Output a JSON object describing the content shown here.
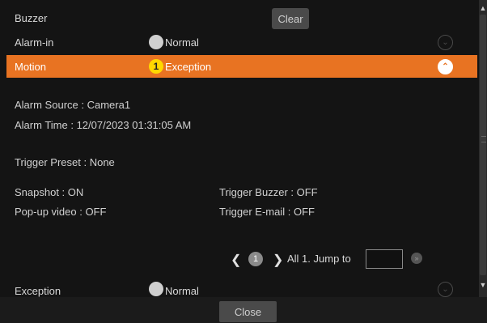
{
  "header": {
    "title": "Buzzer",
    "clear_label": "Clear"
  },
  "rows": [
    {
      "name": "Alarm-in",
      "status": "Normal"
    },
    {
      "name": "Motion",
      "status": "Exception",
      "badge": "1"
    },
    {
      "name": "Exception",
      "status": "Normal"
    }
  ],
  "details": {
    "alarm_source": "Alarm Source   : Camera1",
    "alarm_time": "Alarm Time    : 12/07/2023 01:31:05 AM",
    "trigger_preset": "Trigger Preset    : None",
    "snapshot": "Snapshot : ON",
    "popup_video": "Pop-up video : OFF",
    "trigger_buzzer": "Trigger Buzzer : OFF",
    "trigger_email": "Trigger E-mail : OFF"
  },
  "pager": {
    "page": "1",
    "summary": "All 1. Jump to",
    "jump_value": ""
  },
  "footer": {
    "close_label": "Close"
  },
  "colors": {
    "accent": "#e87322",
    "badge": "#ffd800",
    "background": "#141414"
  },
  "icons": {
    "chevron_down": "chevron-down-icon",
    "chevron_up": "chevron-up-icon",
    "prev": "chevron-left-icon",
    "next": "chevron-right-icon",
    "go": "go-arrow-icon"
  }
}
